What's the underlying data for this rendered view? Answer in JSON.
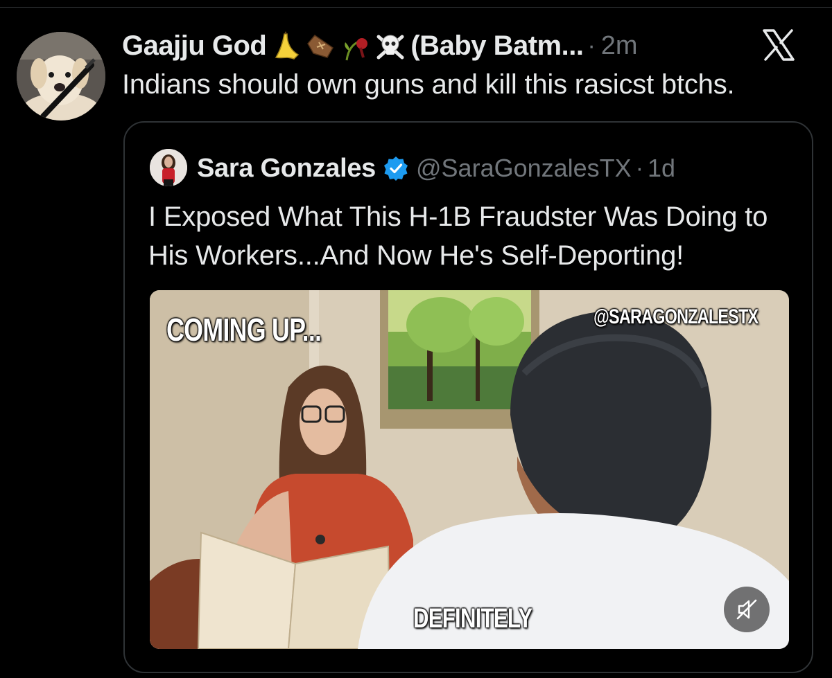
{
  "post": {
    "author_name": "Gaajju God",
    "author_emojis": [
      "banana-emoji",
      "coffin-emoji",
      "wilted-flower-emoji",
      "skull-crossbones-emoji"
    ],
    "author_suffix": "(Baby Batm...",
    "separator": "·",
    "timestamp": "2m",
    "text": "Indians should own guns and kill this rasicst btchs.",
    "avatar_icon": "puppy-avatar"
  },
  "platform_logo": "x-logo-icon",
  "quoted_post": {
    "author_name": "Sara Gonzales",
    "verified_icon": "verified-badge-icon",
    "handle": "@SaraGonzalesTX",
    "separator": "·",
    "timestamp": "1d",
    "text": "I Exposed What This H-1B Fraudster Was Doing to His Workers...And Now He's Self-Deporting!",
    "video": {
      "overlay_top_left": "COMING UP...",
      "overlay_watermark": "@SARAGONZALESTX",
      "overlay_caption": "DEFINITELY",
      "mute_icon": "speaker-muted-icon"
    }
  },
  "colors": {
    "background": "#000000",
    "text_primary": "#e7e9ea",
    "text_secondary": "#71767b",
    "border": "#2f3336",
    "verified_blue": "#1d9bf0"
  }
}
